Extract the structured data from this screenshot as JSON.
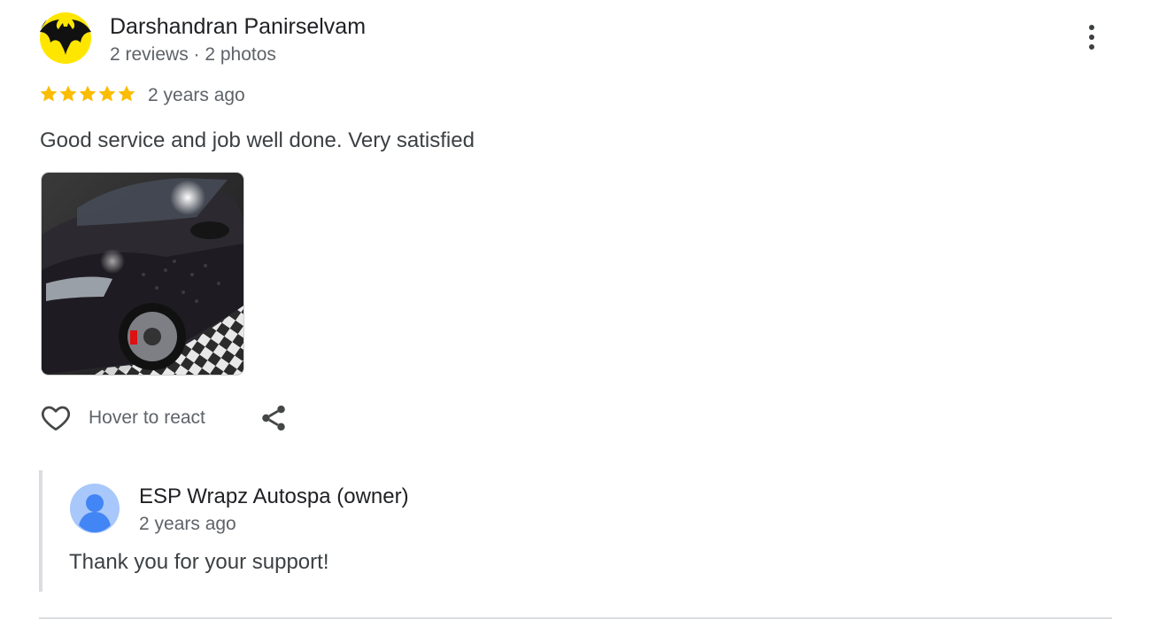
{
  "review": {
    "reviewer_name": "Darshandran Panirselvam",
    "reviewer_meta": "2 reviews · 2 photos",
    "rating": 5,
    "rating_max": 5,
    "time": "2 years ago",
    "text": "Good service and job well done. Very satisfied",
    "react_label": "Hover to react"
  },
  "reply": {
    "owner_name": "ESP Wrapz Autospa (owner)",
    "time": "2 years ago",
    "text": "Thank you for your support!"
  },
  "colors": {
    "star": "#fbbc04",
    "bat_yellow": "#ffe600",
    "owner_avatar_bg": "#a8c7fa",
    "owner_avatar_fg": "#4285f4"
  },
  "icons": {
    "avatar": "batman-logo-avatar",
    "more": "more-vert-icon",
    "react": "heart-outline-icon",
    "share": "share-icon",
    "owner_avatar": "default-person-icon"
  }
}
